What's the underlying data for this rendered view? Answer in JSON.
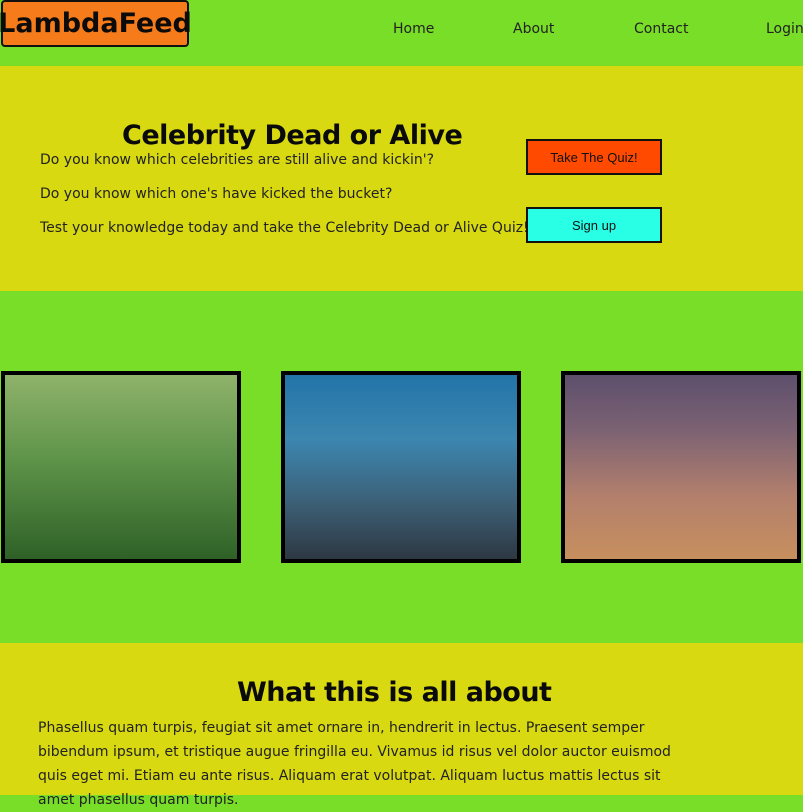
{
  "header": {
    "logo": "LambdaFeed",
    "nav": [
      "Home",
      "About",
      "Contact",
      "Login"
    ]
  },
  "hero": {
    "title": "Celebrity Dead or Alive",
    "lines": [
      "Do you know which celebrities are still alive and kickin'?",
      "Do you know which one's have kicked the bucket?",
      "Test your knowledge today and take the Celebrity Dead or Alive Quiz!!"
    ],
    "buttons": {
      "quiz": "Take The Quiz!",
      "signup": "Sign up"
    }
  },
  "about": {
    "title": "What this is all about",
    "text": "Phasellus quam turpis, feugiat sit amet ornare in, hendrerit in lectus. Praesent semper bibendum ipsum, et tristique augue fringilla eu. Vivamus id risus vel dolor auctor euismod quis eget mi. Etiam eu ante risus. Aliquam erat volutpat. Aliquam luctus mattis lectus sit amet phasellus quam turpis."
  },
  "colors": {
    "page_background": "#79de28",
    "section_background": "#d8d911",
    "logo_background": "#f67b1a",
    "quiz_button": "#ff4a00",
    "signup_button": "#28ffe5"
  }
}
